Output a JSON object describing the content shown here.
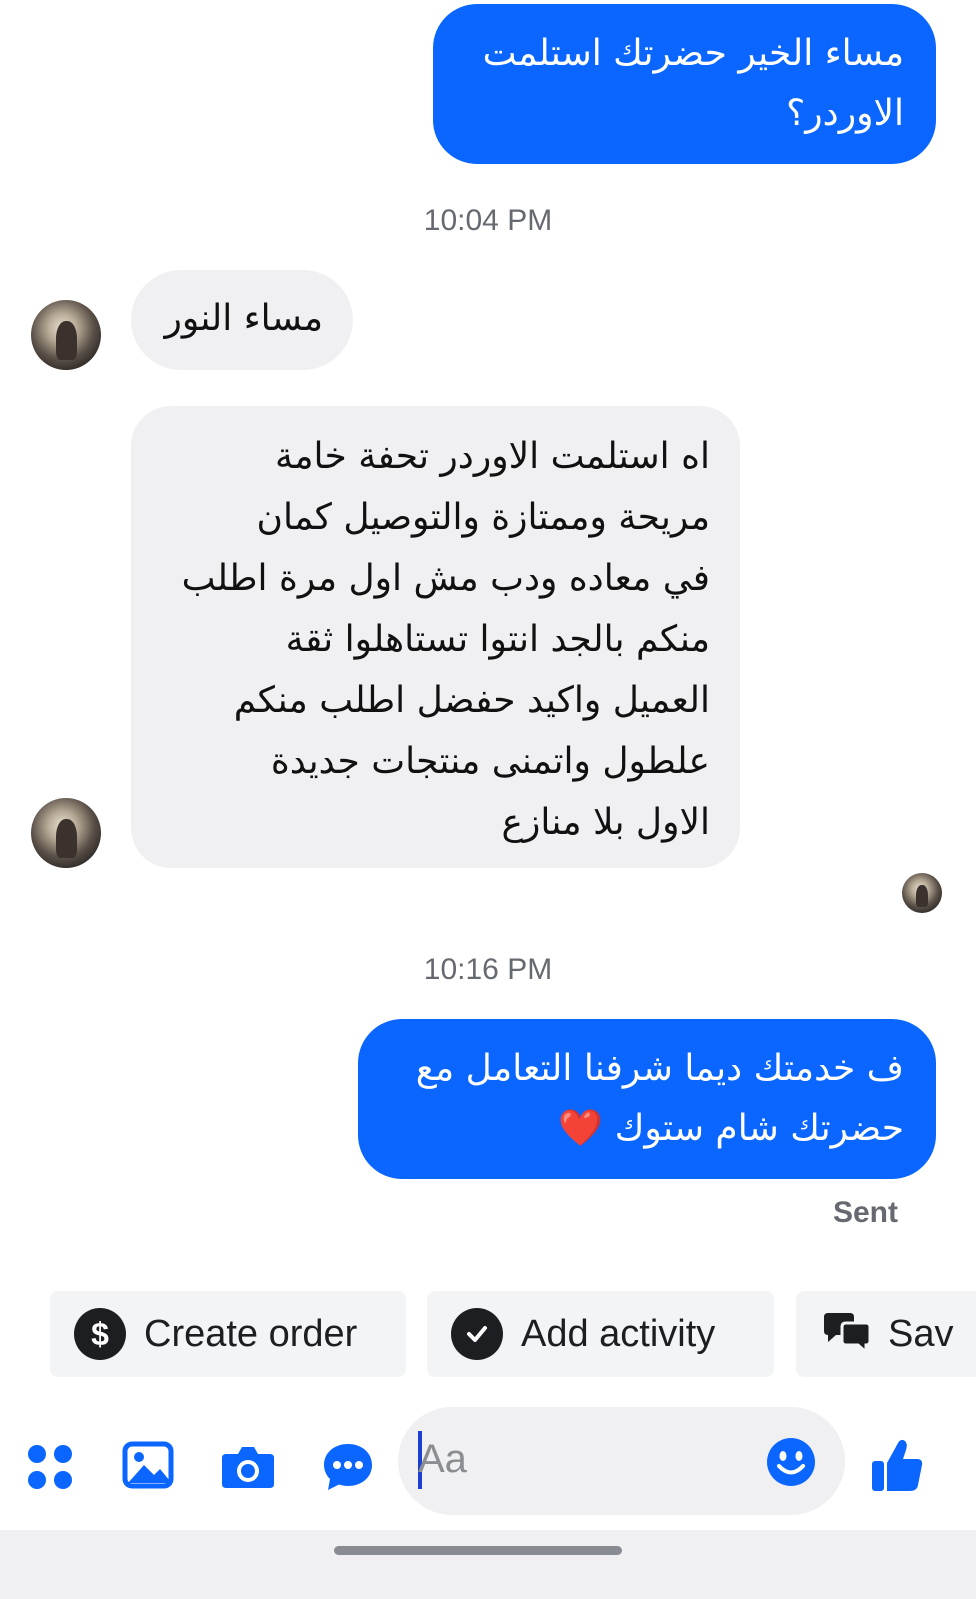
{
  "messages": [
    {
      "direction": "outgoing",
      "lines": [
        "مساء الخير حضرتك استلمت",
        "الاوردر؟"
      ]
    },
    {
      "timestamp": "10:04 PM"
    },
    {
      "direction": "incoming",
      "lines": [
        "مساء النور"
      ]
    },
    {
      "direction": "incoming",
      "lines": [
        "اه استلمت الاوردر  تحفة خامة",
        "مريحة  وممتازة  والتوصيل كمان",
        "في معاده  ودب مش اول مرة اطلب",
        "منكم  بالجد  انتوا  تستاهلوا  ثقة",
        "العميل  واكيد  حفضل  اطلب  منكم",
        "علطول  واتمنى  منتجات  جديدة",
        "الاول  بلا  منازع"
      ]
    },
    {
      "timestamp": "10:16 PM"
    },
    {
      "direction": "outgoing",
      "lines": [
        "ف خدمتك ديما شرفنا التعامل مع",
        "حضرتك شام ستوك"
      ],
      "emoji": "❤️"
    }
  ],
  "status": "Sent",
  "quick_actions": [
    {
      "label": "Create order",
      "icon": "dollar-icon"
    },
    {
      "label": "Add activity",
      "icon": "check-circle-icon"
    },
    {
      "label": "Sav",
      "icon": "speech-bubbles-icon"
    }
  ],
  "composer": {
    "placeholder": "Aa",
    "icons": [
      "apps-grid-icon",
      "image-icon",
      "camera-icon",
      "chat-more-icon",
      "emoji-icon",
      "thumbs-up-icon"
    ]
  },
  "colors": {
    "outgoing_bubble": "#0a66ff",
    "incoming_bubble": "#f0f0f2",
    "icon_blue": "#0a66ff",
    "timestamp": "#666a70"
  }
}
